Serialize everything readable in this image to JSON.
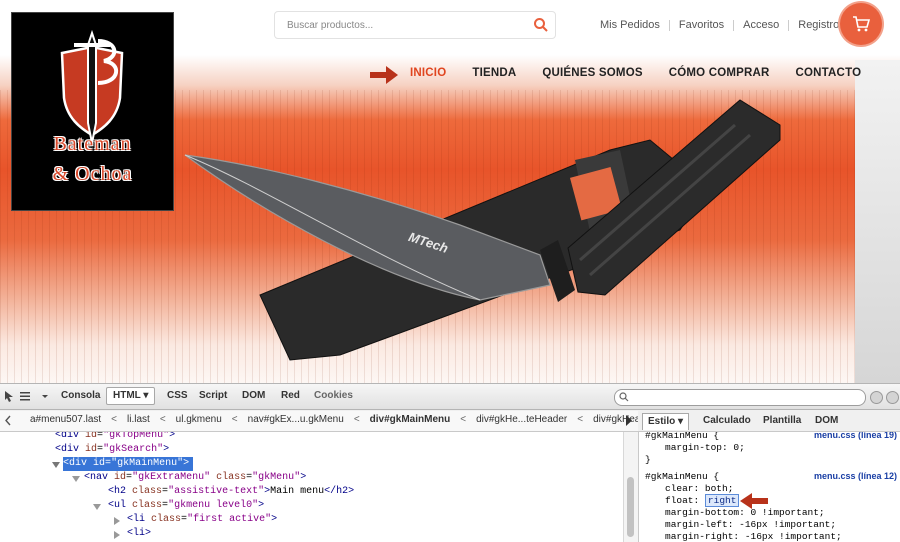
{
  "site": {
    "logo": {
      "line1": "Bateman",
      "amp": "&",
      "line2": "Ochoa"
    },
    "search": {
      "placeholder": "Buscar productos..."
    },
    "top_links": [
      "Mis Pedidos",
      "Favoritos",
      "Acceso",
      "Registro"
    ],
    "main_nav": [
      {
        "label": "INICIO",
        "active": true
      },
      {
        "label": "TIENDA"
      },
      {
        "label": "QUIÉNES SOMOS"
      },
      {
        "label": "CÓMO COMPRAR"
      },
      {
        "label": "CONTACTO"
      }
    ],
    "knife_brand": "MTech",
    "accent_color": "#e9603d"
  },
  "devtools": {
    "tabs": [
      "Consola",
      "HTML",
      "CSS",
      "Script",
      "DOM",
      "Red",
      "Cookies"
    ],
    "active_tab": "HTML",
    "breadcrumbs": [
      "a#menu507.last",
      "li.last",
      "ul.gkmenu",
      "nav#gkEx...u.gkMenu",
      "div#gkMainMenu",
      "div#gkHe...teHeader",
      "div#gkHead"
    ],
    "side_tabs": [
      "Estilo",
      "Calculado",
      "Plantilla",
      "DOM"
    ],
    "tree": [
      {
        "tag": "div",
        "attr": "id",
        "val": "gkTopMenu"
      },
      {
        "tag": "div",
        "attr": "id",
        "val": "gkSearch"
      },
      {
        "tag": "div",
        "attr": "id",
        "val": "gkMainMenu"
      },
      {
        "tag": "nav",
        "attr": "id",
        "val": "gkExtraMenu",
        "attr2": "class",
        "val2": "gkMenu"
      },
      {
        "tag": "h2",
        "attr": "class",
        "val": "assistive-text",
        "text": "Main menu"
      },
      {
        "tag": "ul",
        "attr": "class",
        "val": "gkmenu level0"
      },
      {
        "tag": "li",
        "attr": "class",
        "val": "first active"
      },
      {
        "tag": "li"
      }
    ],
    "rules": [
      {
        "selector": "#gkMainMenu {",
        "source": "menu.css (línea 19)",
        "decls": [
          "margin-top: 0;"
        ]
      },
      {
        "selector": "#gkMainMenu {",
        "source": "menu.css (línea 12)",
        "decls": [
          "clear: both;",
          "float:",
          "margin-bottom: 0 !important;",
          "margin-left: -16px !important;",
          "margin-right: -16px !important;"
        ],
        "float_value": "right"
      }
    ],
    "closing_brace": "}"
  }
}
